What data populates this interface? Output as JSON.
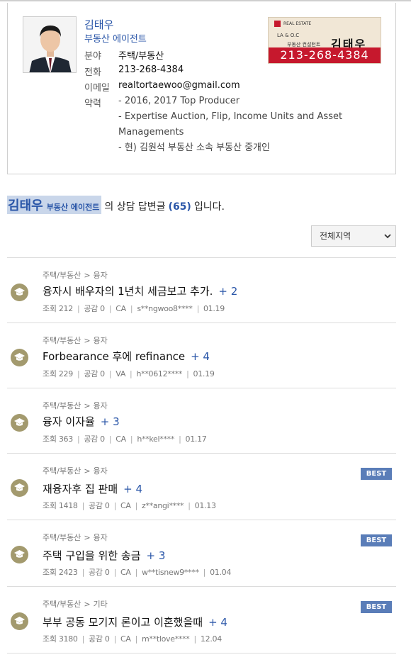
{
  "profile": {
    "name": "김태우",
    "role": "부동산 에이전트",
    "rows": {
      "field": {
        "label": "분야",
        "value": "주택/부동산"
      },
      "phone": {
        "label": "전화",
        "value": "213-268-4384"
      },
      "email": {
        "label": "이메일",
        "value": "realtortaewoo@gmail.com"
      },
      "career": {
        "label": "약력",
        "lines": [
          "- 2016, 2017 Top Producer",
          "- Expertise Auction, Flip, Income Units and Asset",
          "Managements",
          "- 현) 김원석 부동산 소속 부동산 중개인"
        ]
      }
    },
    "badge": {
      "top": "REAL ESTATE",
      "laoc": "LA & O.C",
      "sub": "부동산 컨설턴트",
      "name": "김태우",
      "phone": "213-268-4384"
    }
  },
  "heading": {
    "name": "김태우",
    "role": "부동산 에이전트",
    "pre": "의 상담 답변글",
    "count": "(65)",
    "post": "입니다."
  },
  "region_select": {
    "value": "전체지역",
    "icon": "chevron-down-icon"
  },
  "questions": [
    {
      "cat": "주택/부동산",
      "sub": "융자",
      "title": "융자시 배우자의 1년치 세금보고 추가.",
      "plus": "+ 2",
      "views": "조회 212",
      "likes": "공감 0",
      "region": "CA",
      "user": "s**ngwoo8****",
      "date": "01.19",
      "best": ""
    },
    {
      "cat": "주택/부동산",
      "sub": "융자",
      "title": "Forbearance 후에 refinance",
      "plus": "+ 4",
      "views": "조회 229",
      "likes": "공감 0",
      "region": "VA",
      "user": "h**0612****",
      "date": "01.19",
      "best": ""
    },
    {
      "cat": "주택/부동산",
      "sub": "융자",
      "title": "융자 이자율",
      "plus": "+ 3",
      "views": "조회 363",
      "likes": "공감 0",
      "region": "CA",
      "user": "h**kel****",
      "date": "01.17",
      "best": ""
    },
    {
      "cat": "주택/부동산",
      "sub": "융자",
      "title": "재융자후 집 판매",
      "plus": "+ 4",
      "views": "조회 1418",
      "likes": "공감 0",
      "region": "CA",
      "user": "z**angi****",
      "date": "01.13",
      "best": "BEST"
    },
    {
      "cat": "주택/부동산",
      "sub": "융자",
      "title": "주택 구입을 위한 송금",
      "plus": "+ 3",
      "views": "조회 2423",
      "likes": "공감 0",
      "region": "CA",
      "user": "w**tisnew9****",
      "date": "01.04",
      "best": "BEST"
    },
    {
      "cat": "주택/부동산",
      "sub": "기타",
      "title": "부부 공동 모기지 론이고 이혼했을때",
      "plus": "+ 4",
      "views": "조회 3180",
      "likes": "공감 0",
      "region": "CA",
      "user": "m**tlove****",
      "date": "12.04",
      "best": "BEST"
    }
  ],
  "colors": {
    "accent": "#2a56a8",
    "best": "#5a7db8",
    "icon_bg": "#a39a6e",
    "badge_red": "#c6182d"
  }
}
